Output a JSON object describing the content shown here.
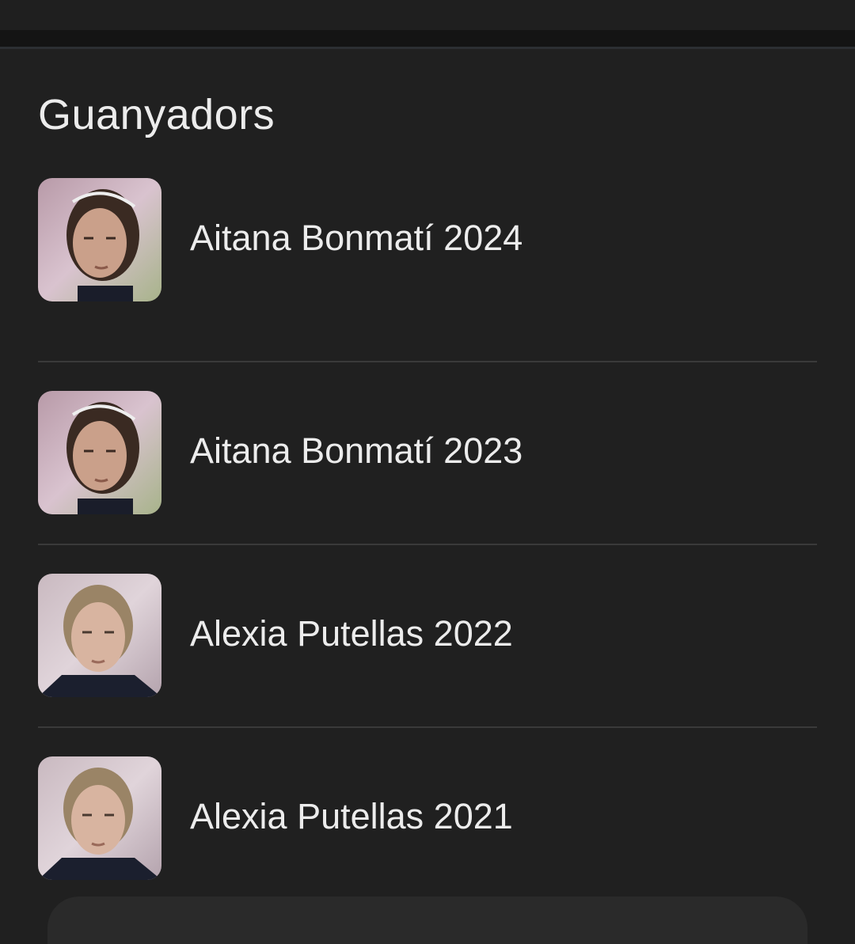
{
  "section": {
    "title": "Guanyadors"
  },
  "winners": [
    {
      "name": "Aitana Bonmatí 2024",
      "photo": "player-photo-aitana"
    },
    {
      "name": "Aitana Bonmatí 2023",
      "photo": "player-photo-aitana"
    },
    {
      "name": "Alexia Putellas 2022",
      "photo": "player-photo-alexia"
    },
    {
      "name": "Alexia Putellas 2021",
      "photo": "player-photo-alexia"
    }
  ],
  "colors": {
    "background": "#202020",
    "text": "#ececec",
    "divider": "#3a3a3a"
  }
}
